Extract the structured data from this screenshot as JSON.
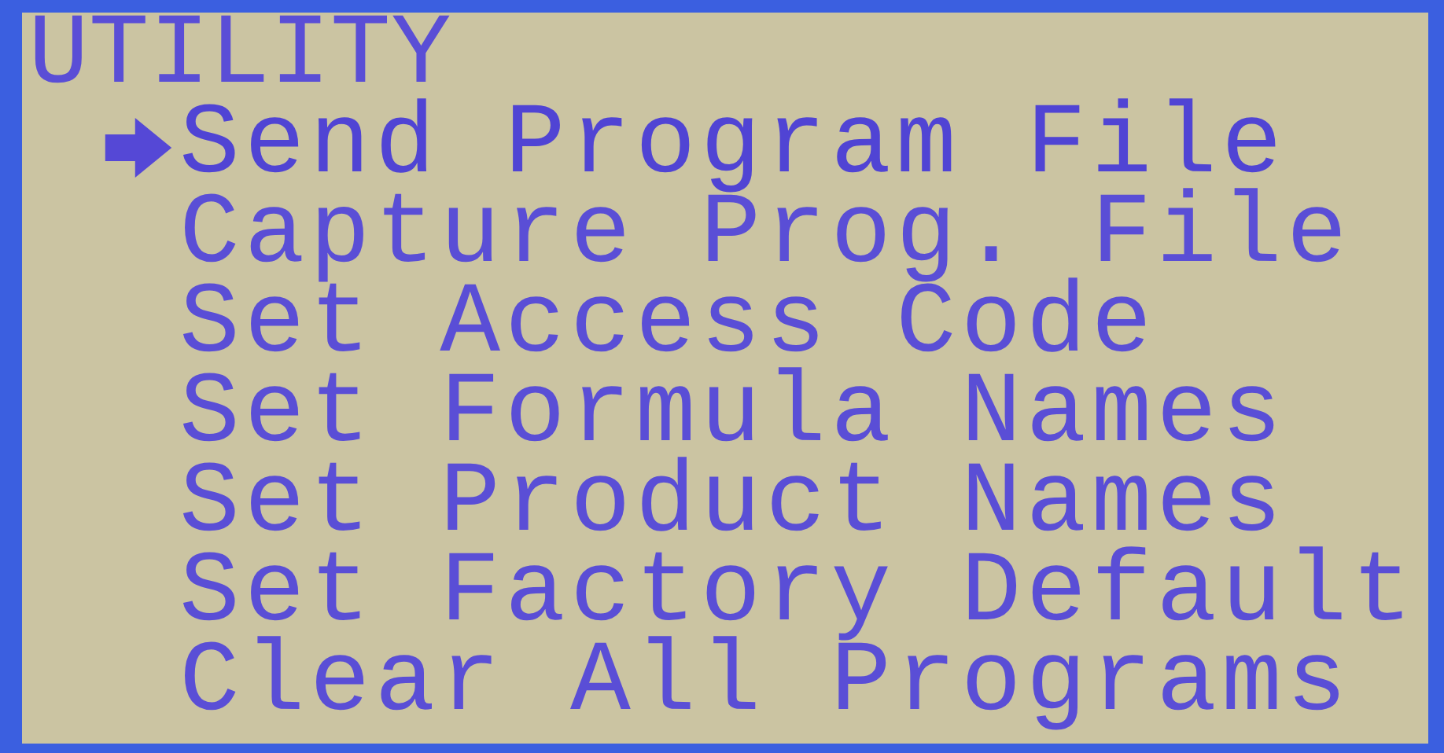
{
  "title": "UTILITY",
  "menu": [
    {
      "label": "Send Program File",
      "selected": true
    },
    {
      "label": "Capture Prog. File",
      "selected": false
    },
    {
      "label": "Set Access Code",
      "selected": false
    },
    {
      "label": "Set Formula Names",
      "selected": false
    },
    {
      "label": "Set Product Names",
      "selected": false
    },
    {
      "label": "Set Factory Default",
      "selected": false
    },
    {
      "label": "Clear All Programs",
      "selected": false
    }
  ]
}
